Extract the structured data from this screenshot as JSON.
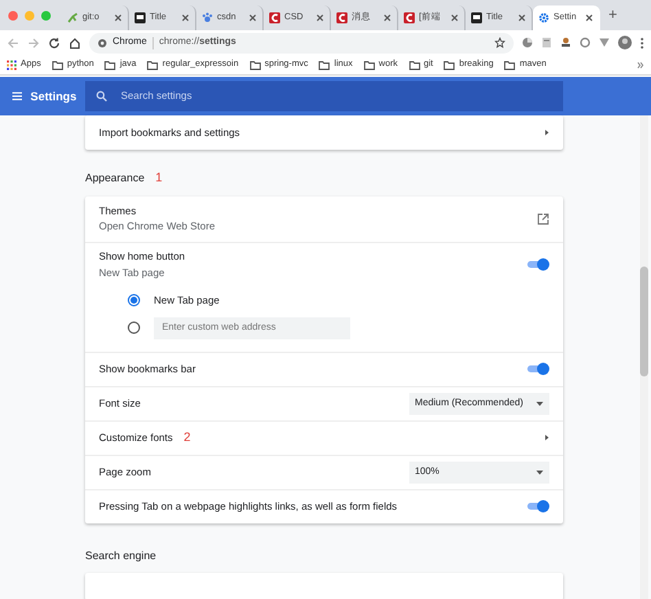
{
  "tabs": [
    {
      "title": "git:o",
      "kind": "branch",
      "selected": false
    },
    {
      "title": "Title",
      "kind": "monitor",
      "selected": false
    },
    {
      "title": "csdn",
      "kind": "paw",
      "selected": false
    },
    {
      "title": "CSD",
      "kind": "csdn",
      "selected": false
    },
    {
      "title": "消息",
      "kind": "csdn",
      "selected": false
    },
    {
      "title": "[前端",
      "kind": "csdn",
      "selected": false
    },
    {
      "title": "Title",
      "kind": "monitor",
      "selected": false
    },
    {
      "title": "Settin",
      "kind": "gear",
      "selected": true
    }
  ],
  "new_tab": "+",
  "omnibox": {
    "chip": "Chrome",
    "url": "chrome://**settings**"
  },
  "bookmarks": [
    {
      "label": "Apps",
      "kind": "apps"
    },
    {
      "label": "python",
      "kind": "folder"
    },
    {
      "label": "java",
      "kind": "folder"
    },
    {
      "label": "regular_expressoin",
      "kind": "folder"
    },
    {
      "label": "spring-mvc",
      "kind": "folder"
    },
    {
      "label": "linux",
      "kind": "folder"
    },
    {
      "label": "work",
      "kind": "folder"
    },
    {
      "label": "git",
      "kind": "folder"
    },
    {
      "label": "breaking",
      "kind": "folder"
    },
    {
      "label": "maven",
      "kind": "folder"
    }
  ],
  "header": {
    "title": "Settings",
    "search_placeholder": "Search settings"
  },
  "import_row": {
    "label": "Import bookmarks and settings"
  },
  "appearance": {
    "heading": "Appearance",
    "annotation": "1",
    "rows": [
      {
        "kind": "link",
        "label": "Themes",
        "sublabel": "Open Chrome Web Store"
      },
      {
        "kind": "toggle",
        "label": "Show home button",
        "sublabel": "New Tab page",
        "on": true
      },
      {
        "kind": "radio",
        "label": "New Tab page",
        "selected": true
      },
      {
        "kind": "radio-input",
        "placeholder": "Enter custom web address",
        "selected": false
      },
      {
        "kind": "toggle",
        "label": "Show bookmarks bar",
        "on": true
      },
      {
        "kind": "select",
        "label": "Font size",
        "value": "Medium (Recommended)"
      },
      {
        "kind": "arrow",
        "label": "Customize fonts",
        "annotation": "2"
      },
      {
        "kind": "select",
        "label": "Page zoom",
        "value": "100%"
      },
      {
        "kind": "toggle",
        "label": "Pressing Tab on a webpage highlights links, as well as form fields",
        "on": true
      }
    ]
  },
  "search_engine": {
    "heading": "Search engine"
  }
}
